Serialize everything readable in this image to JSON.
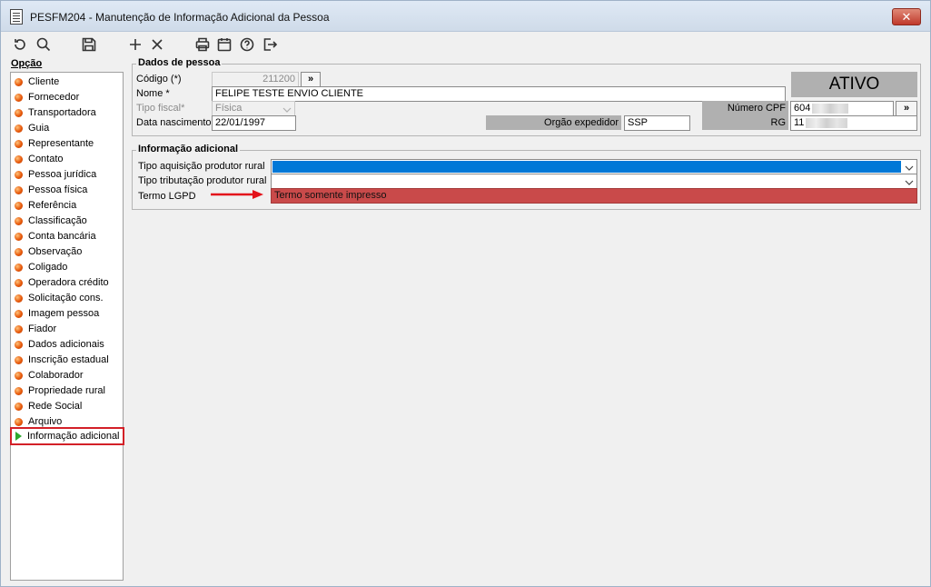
{
  "window": {
    "title": "PESFM204 - Manutenção de Informação Adicional da Pessoa",
    "close_label": "✕"
  },
  "toolbar": {
    "buttons": [
      "refresh-icon",
      "search-icon",
      "save-icon",
      "add-icon",
      "delete-icon",
      "print-icon",
      "calendar-icon",
      "help-icon",
      "exit-icon"
    ]
  },
  "sidebar": {
    "title": "Opção",
    "items": [
      "Cliente",
      "Fornecedor",
      "Transportadora",
      "Guia",
      "Representante",
      "Contato",
      "Pessoa jurídica",
      "Pessoa física",
      "Referência",
      "Classificação",
      "Conta bancária",
      "Observação",
      "Coligado",
      "Operadora crédito",
      "Solicitação cons.",
      "Imagem pessoa",
      "Fiador",
      "Dados adicionais",
      "Inscrição estadual",
      "Colaborador",
      "Propriedade rural",
      "Rede Social",
      "Arquivo",
      "Informação adicional"
    ],
    "selected_index": 23
  },
  "dados_pessoa": {
    "group_title": "Dados de pessoa",
    "codigo_label": "Código (*)",
    "codigo_value": "211200",
    "goto_label": "»",
    "nome_label": "Nome *",
    "nome_value": "FELIPE TESTE ENVIO CLIENTE",
    "tipo_fiscal_label": "Tipo fiscal*",
    "tipo_fiscal_value": "Física",
    "data_nasc_label": "Data nascimento",
    "data_nasc_value": "22/01/1997",
    "orgao_label": "Orgão expedidor",
    "orgao_value": "SSP",
    "status": "ATIVO",
    "cpf_label": "Número CPF",
    "cpf_value": "604",
    "cpf_goto": "»",
    "rg_label": "RG",
    "rg_value": "11"
  },
  "info_adicional": {
    "group_title": "Informação adicional",
    "tipo_aquisicao_label": "Tipo aquisição produtor rural",
    "tipo_tributacao_label": "Tipo tributação produtor rural",
    "termo_lgpd_label": "Termo LGPD",
    "termo_lgpd_value": "Termo somente impresso"
  },
  "colors": {
    "selected_combo": "#0078d7",
    "termo_bg": "#c94a4a",
    "annotation": "#e3121b"
  }
}
